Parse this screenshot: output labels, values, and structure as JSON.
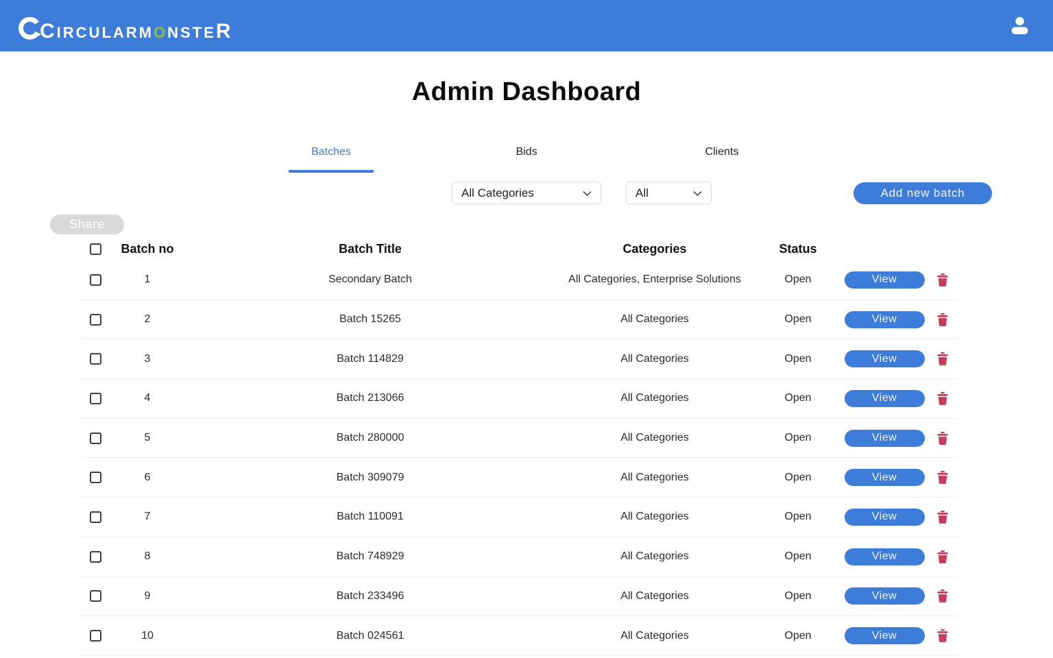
{
  "colors": {
    "accent_blue": "#3d7cd9",
    "logo_green": "#8cbe3f",
    "delete_red": "#c73b5f",
    "disabled_gray": "#d9d9d9"
  },
  "header": {
    "logo_parts": {
      "c": "C",
      "mid1": "IRCULARM",
      "o": "O",
      "mid2": "NSTE",
      "r": "R"
    }
  },
  "page_title": "Admin Dashboard",
  "tabs": [
    {
      "label": "Batches",
      "active": true
    },
    {
      "label": "Bids",
      "active": false
    },
    {
      "label": "Clients",
      "active": false
    }
  ],
  "filters": {
    "categories": {
      "value": "All Categories"
    },
    "status": {
      "value": "All"
    }
  },
  "buttons": {
    "add_new_batch": "Add new batch",
    "share": "Share",
    "view": "View"
  },
  "table": {
    "headers": {
      "batch_no": "Batch no",
      "batch_title": "Batch Title",
      "categories": "Categories",
      "status": "Status"
    },
    "rows": [
      {
        "no": "1",
        "title": "Secondary Batch",
        "categories": "All Categories, Enterprise Solutions",
        "status": "Open"
      },
      {
        "no": "2",
        "title": "Batch 15265",
        "categories": "All Categories",
        "status": "Open"
      },
      {
        "no": "3",
        "title": "Batch 114829",
        "categories": "All Categories",
        "status": "Open"
      },
      {
        "no": "4",
        "title": "Batch 213066",
        "categories": "All Categories",
        "status": "Open"
      },
      {
        "no": "5",
        "title": "Batch 280000",
        "categories": "All Categories",
        "status": "Open"
      },
      {
        "no": "6",
        "title": "Batch 309079",
        "categories": "All Categories",
        "status": "Open"
      },
      {
        "no": "7",
        "title": "Batch 110091",
        "categories": "All Categories",
        "status": "Open"
      },
      {
        "no": "8",
        "title": "Batch 748929",
        "categories": "All Categories",
        "status": "Open"
      },
      {
        "no": "9",
        "title": "Batch 233496",
        "categories": "All Categories",
        "status": "Open"
      },
      {
        "no": "10",
        "title": "Batch 024561",
        "categories": "All Categories",
        "status": "Open"
      }
    ]
  }
}
